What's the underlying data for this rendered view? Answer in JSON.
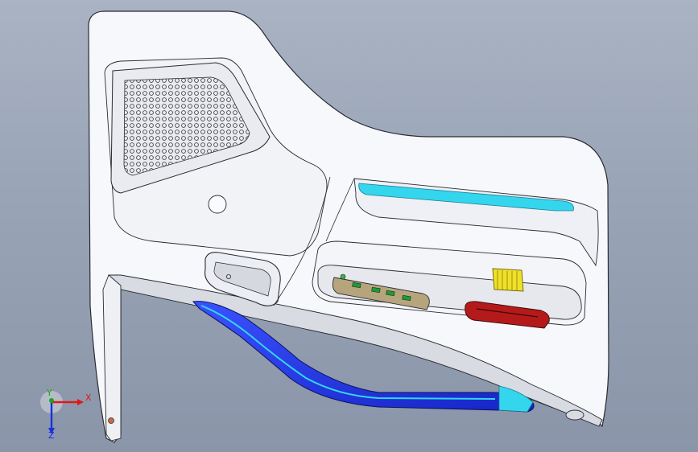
{
  "viewport": {
    "background_top": "#a9b3c3",
    "background_bottom": "#8a95a9"
  },
  "model": {
    "panel_fill": "#f7f8fb",
    "edge_color": "#2a2c33",
    "armrest_color": "#1a2fe0",
    "accent_cyan": "#34d6ee",
    "switch_yellow": "#f0e02a",
    "reflector_red": "#b51a1a",
    "switch_panel_tan": "#b6a57c"
  },
  "triad": {
    "x_label": "X",
    "y_label": "Y",
    "z_label": "Z",
    "x_color": "#e01818",
    "y_color": "#18a818",
    "z_color": "#1830e0"
  }
}
